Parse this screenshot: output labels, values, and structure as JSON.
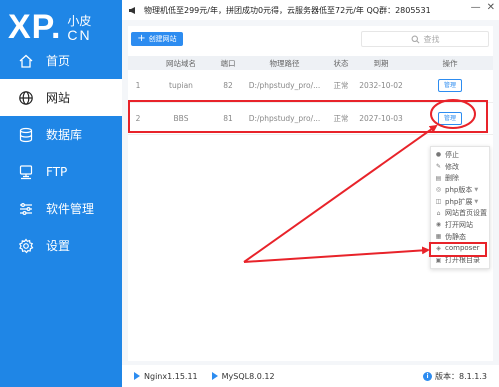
{
  "sidebar": {
    "logo_main": "XP.",
    "logo_top": "小皮",
    "logo_sub": "CN",
    "items": [
      {
        "label": "首页",
        "icon": "home-icon"
      },
      {
        "label": "网站",
        "icon": "globe-icon"
      },
      {
        "label": "数据库",
        "icon": "database-icon"
      },
      {
        "label": "FTP",
        "icon": "server-icon"
      },
      {
        "label": "软件管理",
        "icon": "sliders-icon"
      },
      {
        "label": "设置",
        "icon": "gear-icon"
      }
    ],
    "active_index": 1
  },
  "topbar": {
    "announcement": "物理机低至299元/年，拼团成功0元得，云服务器低至72元/年 QQ群：2805531"
  },
  "toolbar": {
    "create_label": "创建网站",
    "search_placeholder": "查找"
  },
  "table": {
    "headers": [
      "",
      "网站域名",
      "端口",
      "物理路径",
      "状态",
      "到期",
      "操作"
    ],
    "rows": [
      {
        "index": "1",
        "domain": "tupian",
        "port": "82",
        "path": "D:/phpstudy_pro/...",
        "status": "正常",
        "expiry": "2032-10-02",
        "action": "管理"
      },
      {
        "index": "2",
        "domain": "BBS",
        "port": "81",
        "path": "D:/phpstudy_pro/...",
        "status": "正常",
        "expiry": "2027-10-03",
        "action": "管理"
      }
    ]
  },
  "dropdown": {
    "items": [
      {
        "label": "停止",
        "icon": "stop-icon",
        "has_sub": false
      },
      {
        "label": "修改",
        "icon": "pencil-icon",
        "has_sub": false
      },
      {
        "label": "删除",
        "icon": "trash-icon",
        "has_sub": false
      },
      {
        "label": "php版本",
        "icon": "php-icon",
        "has_sub": true
      },
      {
        "label": "php扩展",
        "icon": "php-ext-icon",
        "has_sub": true
      },
      {
        "label": "网站首页设置",
        "icon": "home-icon",
        "has_sub": false
      },
      {
        "label": "打开网站",
        "icon": "open-icon",
        "has_sub": false
      },
      {
        "label": "伪静态",
        "icon": "static-icon",
        "has_sub": false
      },
      {
        "label": "composer",
        "icon": "composer-icon",
        "has_sub": false
      },
      {
        "label": "打开根目录",
        "icon": "folder-icon",
        "has_sub": false
      }
    ]
  },
  "footer": {
    "nginx": "Nginx1.15.11",
    "mysql": "MySQL8.0.12",
    "version_label": "版本：",
    "version": "8.1.1.3"
  },
  "colors": {
    "sidebar": "#1f86e6",
    "accent": "#2d8cf0",
    "annotation": "#e8232a"
  }
}
